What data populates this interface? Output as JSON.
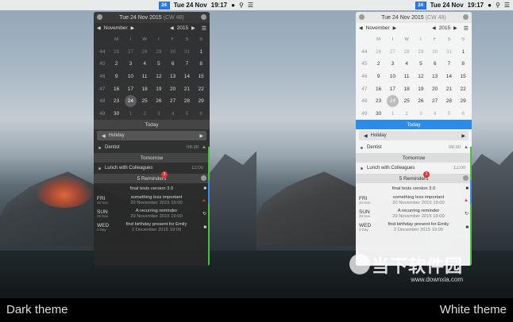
{
  "menubar": {
    "cal_icon_text": "24",
    "date_text": "Tue 24 Nov",
    "time_text": "19:17",
    "icons": [
      "user-icon",
      "search-icon",
      "menu-icon"
    ]
  },
  "panel": {
    "header_date": "Tue 24 Nov 2015",
    "header_cw": "(CW 48)",
    "month": "November",
    "year": "2015",
    "weekday_headers": [
      "M",
      "T",
      "W",
      "T",
      "F",
      "S",
      "S"
    ],
    "weeks": [
      {
        "wk": "44",
        "days": [
          "26",
          "27",
          "28",
          "29",
          "30",
          "31",
          "1"
        ],
        "dim": [
          1,
          1,
          1,
          1,
          1,
          1,
          0
        ]
      },
      {
        "wk": "45",
        "days": [
          "2",
          "3",
          "4",
          "5",
          "6",
          "7",
          "8"
        ],
        "dim": [
          0,
          0,
          0,
          0,
          0,
          0,
          0
        ]
      },
      {
        "wk": "46",
        "days": [
          "9",
          "10",
          "11",
          "12",
          "13",
          "14",
          "15"
        ],
        "dim": [
          0,
          0,
          0,
          0,
          0,
          0,
          0
        ]
      },
      {
        "wk": "47",
        "days": [
          "16",
          "17",
          "18",
          "19",
          "20",
          "21",
          "22"
        ],
        "dim": [
          0,
          0,
          0,
          0,
          0,
          0,
          0
        ]
      },
      {
        "wk": "48",
        "days": [
          "23",
          "24",
          "25",
          "26",
          "27",
          "28",
          "29"
        ],
        "dim": [
          0,
          0,
          0,
          0,
          0,
          0,
          0
        ]
      },
      {
        "wk": "49",
        "days": [
          "30",
          "1",
          "2",
          "3",
          "4",
          "5",
          "6"
        ],
        "dim": [
          0,
          1,
          1,
          1,
          1,
          1,
          1
        ]
      }
    ],
    "today_label": "Today",
    "holiday_label": "Holiday",
    "dentist_label": "Dentist",
    "dentist_time": "08:30",
    "tomorrow_label": "Tomorrow",
    "lunch_label": "Lunch with Colleagues",
    "lunch_time": "12:00",
    "reminders_label": "5 Reminders",
    "reminders_badge": "3",
    "rem_final": "final tests version 3.0",
    "rem_items": [
      {
        "day": "FRI",
        "date": "20 Nov",
        "title": "something less important",
        "sub": "20 November 2015 19:00"
      },
      {
        "day": "SUN",
        "date": "29 Nov",
        "title": "A recurring reminder",
        "sub": "29 November 2015 19:00"
      },
      {
        "day": "WED",
        "date": "3 Day",
        "title": "find birthday present for Emily",
        "sub": "2 December 2015 19:00"
      }
    ]
  },
  "captions": {
    "left": "Dark theme",
    "right": "White theme"
  },
  "watermark": {
    "title": "当下软件园",
    "url": "www.downxia.com"
  }
}
